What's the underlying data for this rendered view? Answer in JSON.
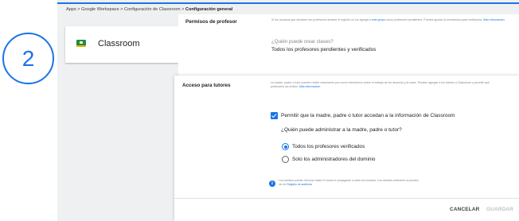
{
  "step_number": "2",
  "breadcrumb": {
    "path": "Apps > Google Workspace > Configuración de Classroom > ",
    "current": "Configuración general"
  },
  "app": {
    "name": "Classroom",
    "logo_icon": "google-classroom-logo"
  },
  "teacher_permissions": {
    "title": "Permisos de profesor",
    "description": "Si los usuarios que declaren ser profesores durante el registro no los agrega a ",
    "description_link": "este grupo",
    "description_tail": " como profesores pendientes. Puedes ajustar la membresía para verificarlos. ",
    "more_info_link": "Más información",
    "question": "¿Quién puede crear clases?",
    "answer": "Todos los profesores pendientes y verificados"
  },
  "guardian_access": {
    "title": "Acceso para tutores",
    "description": "La madre, padre o tutor pueden recibir resúmenes por correo electrónico sobre el trabajo de los alumnos y la clase. Puedes agregar a los tutores a Classroom y permitir que profesores los inviten. ",
    "more_info_link": "Más información",
    "checkbox_label": "Permitir que la madre, padre o tutor accedan a la información de Classroom",
    "checkbox_checked": true,
    "question": "¿Quién puede administrar a la madre, padre o tutor?",
    "options": [
      {
        "label": "Todos los profesores verificados",
        "selected": true
      },
      {
        "label": "Solo los administradores del dominio",
        "selected": false
      }
    ],
    "info_note": "Los cambios pueden demorar hasta 24 horas en propagarse a todos los usuarios. Los cambios anteriores se pueden ver en ",
    "info_note_link": "Registro de auditoría",
    "cancel_label": "CANCELAR",
    "save_label": "GUARDAR"
  },
  "colors": {
    "accent": "#1a73e8",
    "disabled": "#bdc1c6",
    "background": "#eef0f2"
  }
}
